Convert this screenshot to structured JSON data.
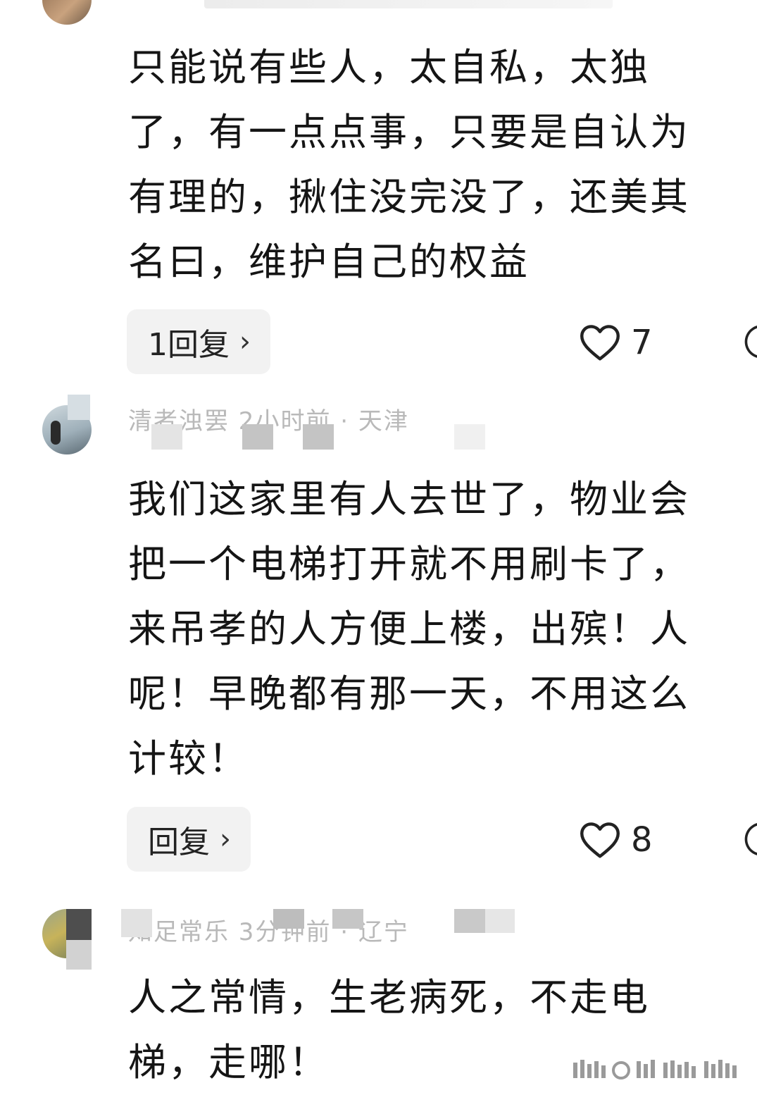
{
  "comments": [
    {
      "lines": [
        "只能说有些人，太自私，太独",
        "了，有一点点事，只要是自认为",
        "有理的，揪住没完没了，还美其",
        "名曰，维护自己的权益"
      ],
      "reply_label": "1回复",
      "likes": "7"
    },
    {
      "meta": "清者浊罢  2小时前 · 天津",
      "lines": [
        "我们这家里有人去世了，物业会",
        "把一个电梯打开就不用刷卡了，",
        "来吊孝的人方便上楼，出殡！人",
        "呢！早晚都有那一天，不用这么",
        "计较！"
      ],
      "reply_label": "回复",
      "likes": "8"
    },
    {
      "meta": "知足常乐  3分钟前 · 辽宁",
      "lines": [
        "人之常情，生老病死，不走电",
        "梯，走哪！"
      ]
    }
  ],
  "icons": {
    "reply_chevron": "chevron-right-icon",
    "like": "heart-outline-icon",
    "comment": "comment-bubble-icon"
  },
  "colors": {
    "text": "#151515",
    "meta": "#b9b9b9",
    "button_bg": "#f2f2f2"
  }
}
